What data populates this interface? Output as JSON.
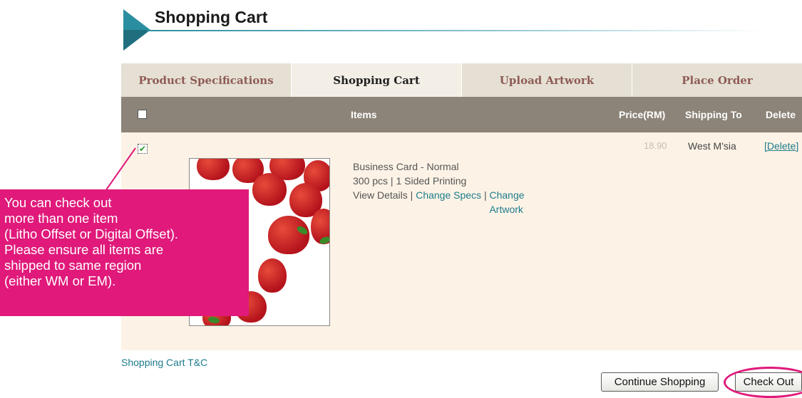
{
  "header": {
    "title": "Shopping Cart"
  },
  "steps": [
    {
      "label": "Product Specifications"
    },
    {
      "label": "Shopping Cart"
    },
    {
      "label": "Upload Artwork"
    },
    {
      "label": "Place Order"
    }
  ],
  "table": {
    "columns": {
      "items": "Items",
      "price": "Price(RM)",
      "shipping": "Shipping To",
      "delete": "Delete"
    },
    "rows": [
      {
        "checked": true,
        "product": "Business Card - Normal",
        "spec": "300 pcs | 1 Sided Printing",
        "view_details": "View Details",
        "separator": "|",
        "change_specs": "Change Specs",
        "change_artwork": "Change Artwork",
        "price": "18.90",
        "shipping_to": "West M'sia",
        "delete_label": "[Delete]"
      }
    ]
  },
  "callout": {
    "lines": [
      "You can check out",
      "more than one item",
      "(Litho Offset or Digital Offset).",
      "Please ensure all items are",
      "shipped to same region",
      "(either WM or EM)."
    ]
  },
  "footer": {
    "tc_link": "Shopping Cart T&C",
    "continue_label": "Continue Shopping",
    "checkout_label": "Check Out"
  },
  "colors": {
    "accent": "#e0197a",
    "teal": "#2a8ea0",
    "header_bar": "#8c8479",
    "row_bg": "#fcf3e6"
  },
  "icons": {
    "title": "triangle-icon",
    "check": "checkmark-icon"
  }
}
